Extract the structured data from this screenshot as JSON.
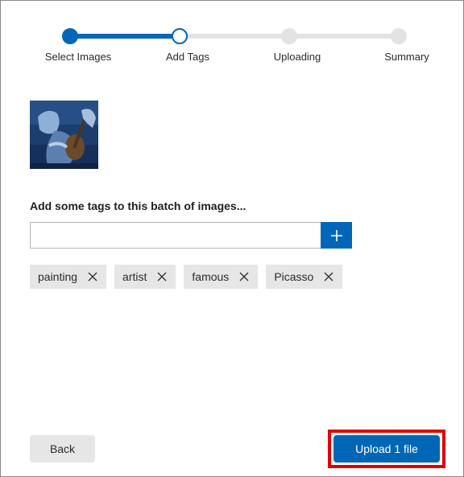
{
  "stepper": {
    "steps": [
      {
        "label": "Select Images",
        "state": "done"
      },
      {
        "label": "Add Tags",
        "state": "current"
      },
      {
        "label": "Uploading",
        "state": "todo"
      },
      {
        "label": "Summary",
        "state": "todo"
      }
    ]
  },
  "thumbnail": {
    "icon": "painting-thumbnail"
  },
  "tags": {
    "heading": "Add some tags to this batch of images...",
    "input_value": "",
    "input_placeholder": "",
    "add_icon": "plus-icon",
    "items": [
      {
        "label": "painting"
      },
      {
        "label": "artist"
      },
      {
        "label": "famous"
      },
      {
        "label": "Picasso"
      }
    ]
  },
  "footer": {
    "back_label": "Back",
    "upload_label": "Upload 1 file"
  },
  "colors": {
    "accent": "#0067b8",
    "chip_bg": "#e6e6e6",
    "highlight": "#e00000"
  }
}
